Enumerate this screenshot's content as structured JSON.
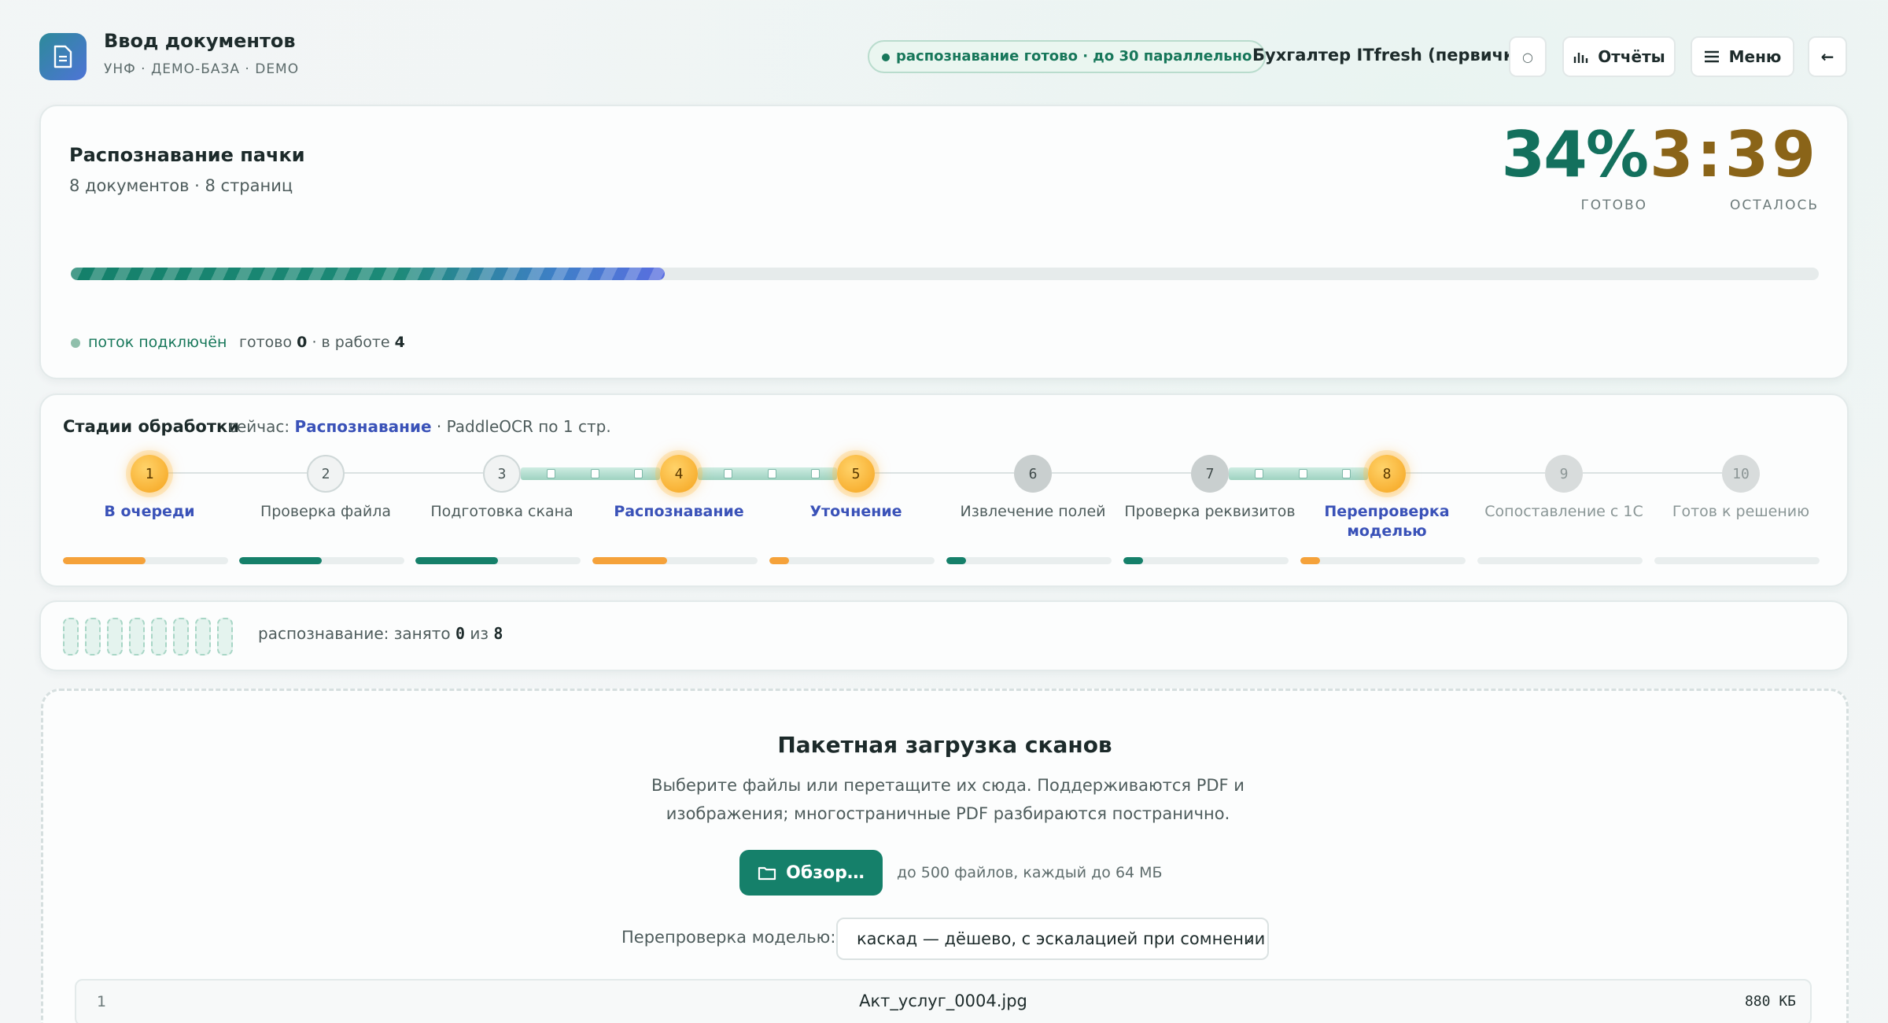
{
  "header": {
    "title": "Ввод документов",
    "subtitle": "УНФ · ДЕМО-БАЗА · DEMO",
    "status_pill": "распознавание готово · до 30 параллельно",
    "user": "Бухгалтер ITfresh (первичка)",
    "theme_glyph": "○",
    "reports_label": "Отчёты",
    "menu_label": "Меню",
    "back_glyph": "←"
  },
  "progress": {
    "title": "Распознавание пачки",
    "subtitle": "8 документов · 8 страниц",
    "percent_text": "34%",
    "percent_label": "ГОТОВО",
    "remaining_text": "3:39",
    "remaining_label": "ОСТАЛОСЬ",
    "fraction": 0.34,
    "stream_text": "поток подключён",
    "ready_label": "готово",
    "ready_count": "0",
    "sep": " · ",
    "working_label": "в работе",
    "working_count": "4"
  },
  "stages": {
    "title": "Стадии обработки",
    "now_prefix": "сейчас: ",
    "now_stage": "Распознавание",
    "now_suffix": " · PaddleOCR по 1 стр.",
    "items": [
      {
        "num": "1",
        "label": "В очереди",
        "state": "active",
        "bar": 0.5,
        "bar_color": "#f5a23a"
      },
      {
        "num": "2",
        "label": "Проверка файла",
        "state": "done",
        "bar": 0.5,
        "bar_color": "#15806a"
      },
      {
        "num": "3",
        "label": "Подготовка скана",
        "state": "done",
        "bar": 0.5,
        "bar_color": "#15806a"
      },
      {
        "num": "4",
        "label": "Распознавание",
        "state": "active",
        "bar": 0.45,
        "bar_color": "#f5a23a"
      },
      {
        "num": "5",
        "label": "Уточнение",
        "state": "active",
        "bar": 0.12,
        "bar_color": "#f5a23a"
      },
      {
        "num": "6",
        "label": "Извлечение полей",
        "state": "pending",
        "bar": 0.12,
        "bar_color": "#15806a"
      },
      {
        "num": "7",
        "label": "Проверка реквизитов",
        "state": "pending",
        "bar": 0.12,
        "bar_color": "#15806a"
      },
      {
        "num": "8",
        "label": "Перепроверка моделью",
        "state": "active",
        "bar": 0.12,
        "bar_color": "#f5a23a"
      },
      {
        "num": "9",
        "label": "Сопоставление с 1С",
        "state": "idle",
        "bar": 0,
        "bar_color": "#15806a"
      },
      {
        "num": "10",
        "label": "Готов к решению",
        "state": "idle",
        "bar": 0,
        "bar_color": "#15806a"
      }
    ]
  },
  "slots": {
    "prefix": "распознавание: занято ",
    "busy": "0",
    "middle": " из ",
    "total": "8",
    "count": 8
  },
  "upload": {
    "title": "Пакетная загрузка сканов",
    "description": "Выберите файлы или перетащите их сюда. Поддерживаются PDF и изображения; многостраничные PDF разбираются постранично.",
    "browse_label": "Обзор…",
    "limit": "до 500 файлов, каждый до 64 МБ",
    "recheck_label": "Перепроверка моделью:",
    "recheck_value": "каскад — дёшево, с эскалацией при сомнении",
    "files": [
      {
        "index": "1",
        "name": "Акт_услуг_0004.jpg",
        "size": "880 КБ"
      }
    ]
  },
  "colors": {
    "accent": "#15806a",
    "percent": "#13705d",
    "remaining": "#8a6418",
    "stage_highlight": "#3a52b8",
    "orange": "#f5a23a"
  }
}
